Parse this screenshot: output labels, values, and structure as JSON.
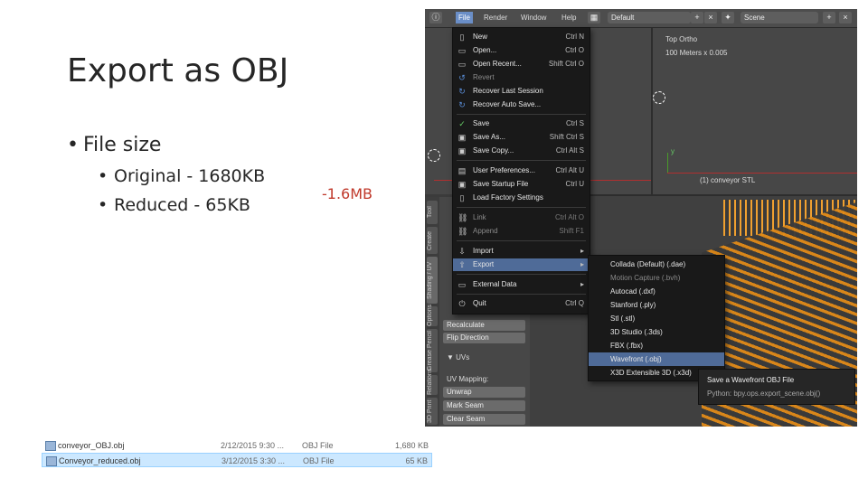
{
  "slide": {
    "title": "Export as OBJ",
    "bullet": "File size",
    "sub_bullets": [
      "Original  - 1680KB",
      "Reduced - 65KB"
    ],
    "delta": "-1.6MB",
    "delta_color": "#c0392b"
  },
  "blender": {
    "menubar": [
      "File",
      "Render",
      "Window",
      "Help"
    ],
    "layout_field": "Default",
    "scene_field": "Scene",
    "viewport_top_label": "Top Ortho",
    "viewport_scale": "100 Meters x 0.005",
    "object_label": "(1) conveyor STL",
    "side_tabs": [
      "Tool",
      "Create",
      "Shading / UV",
      "Grease Pencil",
      "Options",
      "Relations",
      "3D Print"
    ],
    "side_panel": {
      "buttons": [
        "Recalculate",
        "Flip Direction"
      ],
      "uvs_header": "UVs",
      "uv_mapping_label": "UV Mapping:",
      "uv_buttons": [
        "Unwrap",
        "Mark Seam",
        "Clear Seam"
      ]
    },
    "file_menu": [
      {
        "icon": "new-file-icon",
        "label": "New",
        "shortcut": "Ctrl N"
      },
      {
        "icon": "open-folder-icon",
        "label": "Open...",
        "shortcut": "Ctrl O"
      },
      {
        "icon": "open-recent-icon",
        "label": "Open Recent...",
        "shortcut": "Shift Ctrl O"
      },
      {
        "icon": "revert-icon",
        "label": "Revert",
        "shortcut": "",
        "disabled": true
      },
      {
        "icon": "recover-icon",
        "label": "Recover Last Session",
        "shortcut": ""
      },
      {
        "icon": "recover-auto-icon",
        "label": "Recover Auto Save...",
        "shortcut": ""
      },
      {
        "icon": "save-check-icon",
        "label": "Save",
        "shortcut": "Ctrl S"
      },
      {
        "icon": "save-as-icon",
        "label": "Save As...",
        "shortcut": "Shift Ctrl S"
      },
      {
        "icon": "save-copy-icon",
        "label": "Save Copy...",
        "shortcut": "Ctrl Alt S"
      },
      {
        "icon": "preferences-icon",
        "label": "User Preferences...",
        "shortcut": "Ctrl Alt U"
      },
      {
        "icon": "startup-file-icon",
        "label": "Save Startup File",
        "shortcut": "Ctrl U"
      },
      {
        "icon": "factory-settings-icon",
        "label": "Load Factory Settings",
        "shortcut": ""
      },
      {
        "icon": "link-icon",
        "label": "Link",
        "shortcut": "Ctrl Alt O",
        "disabled": true
      },
      {
        "icon": "append-icon",
        "label": "Append",
        "shortcut": "Shift F1",
        "disabled": true
      },
      {
        "icon": "import-icon",
        "label": "Import",
        "shortcut": "▸"
      },
      {
        "icon": "export-icon",
        "label": "Export",
        "shortcut": "▸",
        "highlighted": true
      },
      {
        "icon": "external-data-icon",
        "label": "External Data",
        "shortcut": "▸"
      },
      {
        "icon": "quit-icon",
        "label": "Quit",
        "shortcut": "Ctrl Q"
      }
    ],
    "export_submenu": [
      {
        "label": "Collada (Default) (.dae)"
      },
      {
        "label": "Motion Capture (.bvh)"
      },
      {
        "label": "Autocad (.dxf)"
      },
      {
        "label": "Stanford (.ply)"
      },
      {
        "label": "Stl (.stl)"
      },
      {
        "label": "3D Studio (.3ds)"
      },
      {
        "label": "FBX (.fbx)"
      },
      {
        "label": "Wavefront (.obj)",
        "highlighted": true
      },
      {
        "label": "X3D Extensible 3D (.x3d)"
      }
    ],
    "tooltip": {
      "title": "Save a Wavefront OBJ File",
      "python": "Python: bpy.ops.export_scene.obj()"
    }
  },
  "files": [
    {
      "name": "conveyor_OBJ.obj",
      "date": "2/12/2015 9:30 ...",
      "type": "OBJ File",
      "size": "1,680 KB"
    },
    {
      "name": "Conveyor_reduced.obj",
      "date": "3/12/2015 3:30 ...",
      "type": "OBJ File",
      "size": "65 KB",
      "selected": true
    }
  ]
}
